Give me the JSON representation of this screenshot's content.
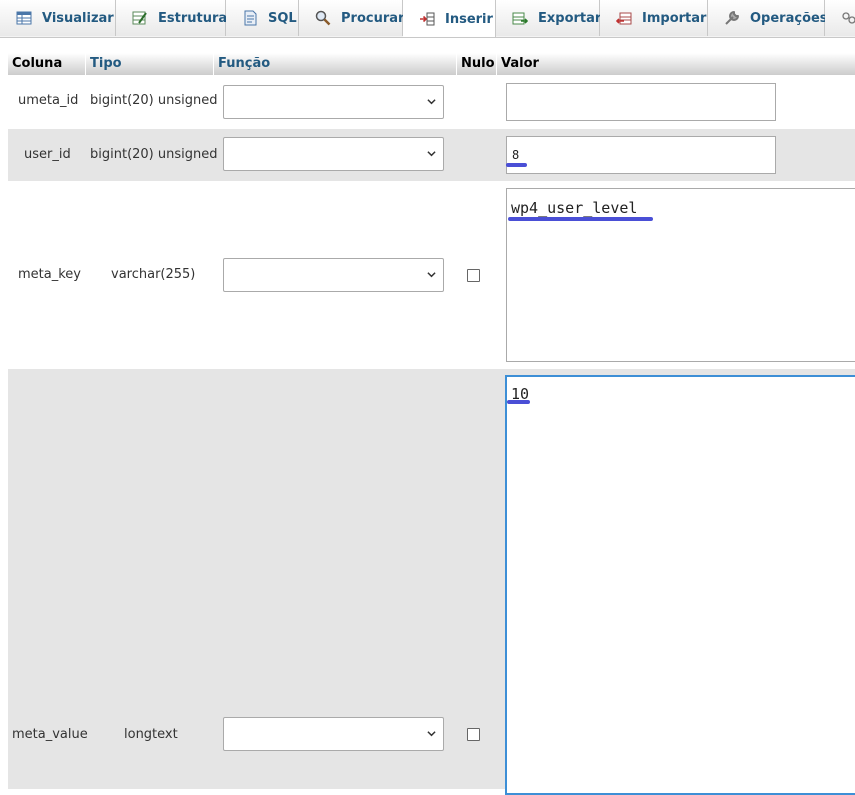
{
  "tabs": [
    {
      "id": "visualizar",
      "label": "Visualizar",
      "icon": "browse-icon",
      "active": false
    },
    {
      "id": "estrutura",
      "label": "Estrutura",
      "icon": "structure-icon",
      "active": false
    },
    {
      "id": "sql",
      "label": "SQL",
      "icon": "sql-icon",
      "active": false
    },
    {
      "id": "procurar",
      "label": "Procurar",
      "icon": "search-icon",
      "active": false
    },
    {
      "id": "inserir",
      "label": "Inserir",
      "icon": "insert-icon",
      "active": true
    },
    {
      "id": "exportar",
      "label": "Exportar",
      "icon": "export-icon",
      "active": false
    },
    {
      "id": "importar",
      "label": "Importar",
      "icon": "import-icon",
      "active": false
    },
    {
      "id": "operacoes",
      "label": "Operações",
      "icon": "wrench-icon",
      "active": false
    }
  ],
  "columns": {
    "coluna": "Coluna",
    "tipo": "Tipo",
    "funcao": "Função",
    "nulo": "Nulo",
    "valor": "Valor"
  },
  "rows": [
    {
      "name": "umeta_id",
      "type": "bigint(20) unsigned",
      "function": "",
      "nullable": false,
      "value": ""
    },
    {
      "name": "user_id",
      "type": "bigint(20) unsigned",
      "function": "",
      "nullable": false,
      "value": "8"
    },
    {
      "name": "meta_key",
      "type": "varchar(255)",
      "function": "",
      "nullable": true,
      "null_checked": false,
      "value": "wp4_user_level"
    },
    {
      "name": "meta_value",
      "type": "longtext",
      "function": "",
      "nullable": true,
      "null_checked": false,
      "value": "10"
    }
  ],
  "colors": {
    "accent": "#235a81",
    "highlight": "#4a4fd6",
    "row_alt": "#e5e5e5",
    "focus": "#3d8fd6"
  }
}
